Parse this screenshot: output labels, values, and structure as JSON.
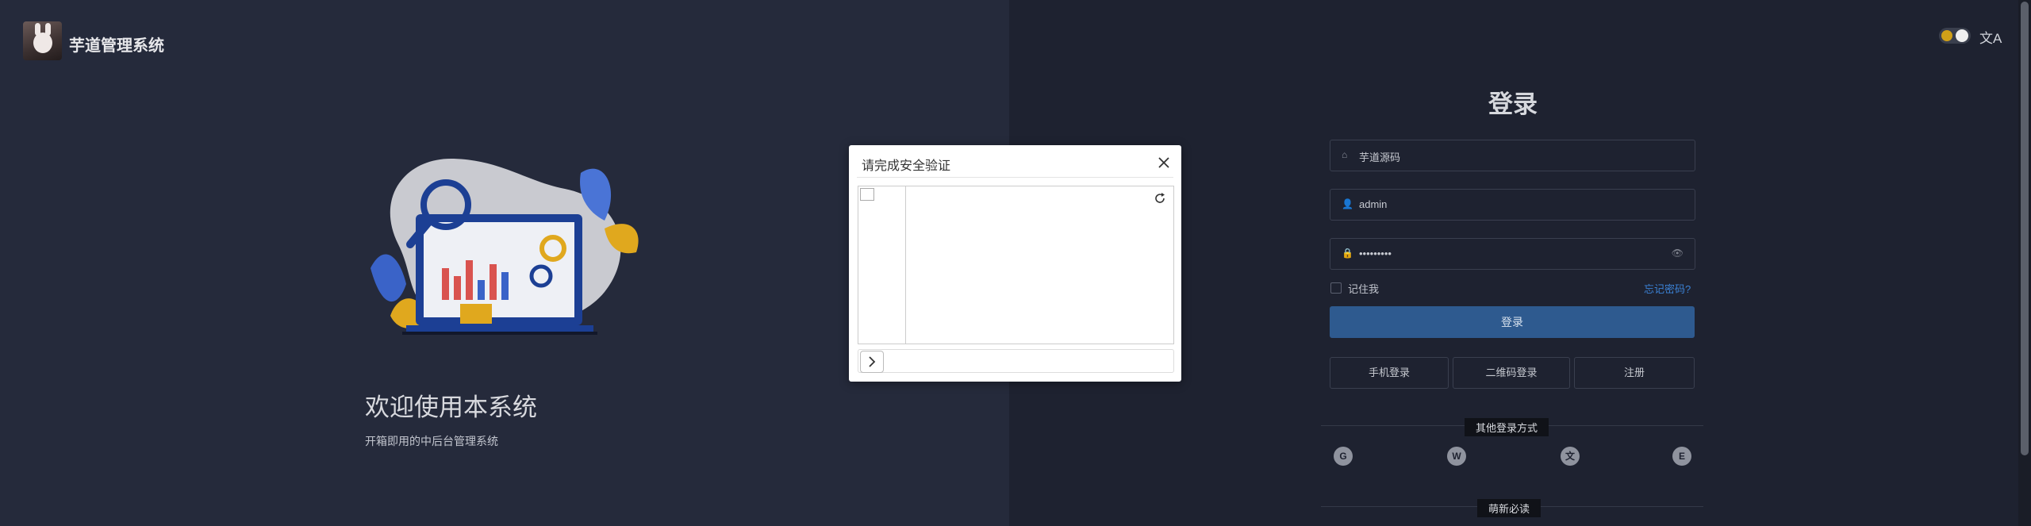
{
  "header": {
    "app_name": "芋道管理系统",
    "logo": "rabbit-avatar"
  },
  "hero": {
    "welcome": "欢迎使用本系统",
    "subtitle": "开箱即用的中后台管理系统"
  },
  "captcha": {
    "title": "请完成安全验证",
    "close_icon": "close-icon",
    "refresh_icon": "refresh-icon",
    "handle_icon": "chevron-right-icon"
  },
  "top_controls": {
    "theme_toggle_icon": "theme-toggle",
    "lang_glyph": "文A"
  },
  "login": {
    "title": "登录",
    "tenant": {
      "value": "芋道源码",
      "icon": "home-icon"
    },
    "username": {
      "value": "admin",
      "icon": "user-icon"
    },
    "password": {
      "value": "•••••••••",
      "icon": "lock-icon",
      "toggle_icon": "eye-icon"
    },
    "remember_label": "记住我",
    "forgot_label": "忘记密码?",
    "submit_label": "登录",
    "alt": [
      "手机登录",
      "二维码登录",
      "注册"
    ],
    "other_methods_label": "其他登录方式",
    "social": [
      {
        "name": "github",
        "glyph": "G"
      },
      {
        "name": "wechat",
        "glyph": "W"
      },
      {
        "name": "dingtalk",
        "glyph": "文"
      },
      {
        "name": "enterprise",
        "glyph": "E"
      }
    ],
    "footer_label": "萌新必读"
  },
  "colors": {
    "accent": "#2e5a8f",
    "link": "#3b82d6",
    "left_bg": "#252a3b",
    "right_bg": "#1e2230"
  }
}
